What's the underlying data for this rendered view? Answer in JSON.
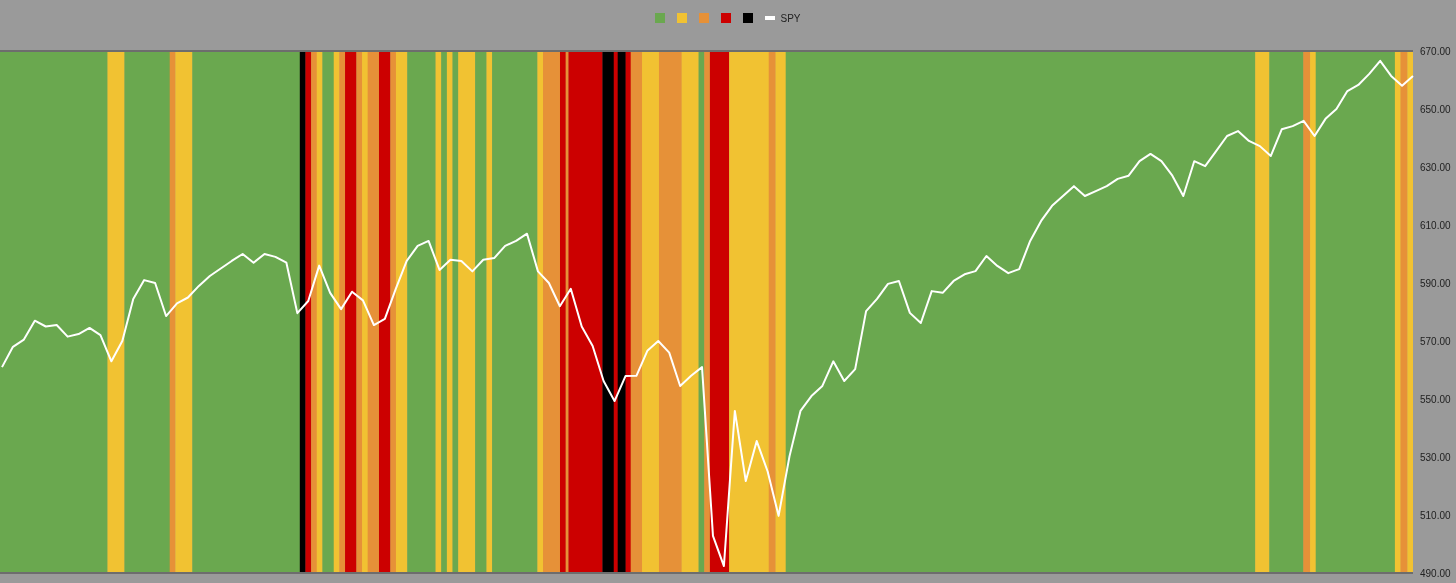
{
  "legend": [
    {
      "color": "#6aa84f"
    },
    {
      "color": "#f1c232"
    },
    {
      "color": "#e69138"
    },
    {
      "color": "#cc0000"
    },
    {
      "color": "#000000"
    }
  ],
  "chart_data": {
    "type": "line",
    "ylim": [
      490,
      670
    ],
    "yticks": [
      {
        "value": 490,
        "label": "490.00"
      },
      {
        "value": 510,
        "label": "510.00"
      },
      {
        "value": 530,
        "label": "530.00"
      },
      {
        "value": 550,
        "label": "550.00"
      },
      {
        "value": 570,
        "label": "570.00"
      },
      {
        "value": 590,
        "label": "590.00"
      },
      {
        "value": 610,
        "label": "610.00"
      },
      {
        "value": 630,
        "label": "630.00"
      },
      {
        "value": 650,
        "label": "650.00"
      },
      {
        "value": 670,
        "label": "670.00"
      }
    ],
    "series": [
      {
        "name": "SPY",
        "color": "#ffffff",
        "values": [
          561,
          568,
          570.5,
          577,
          575,
          575.5,
          571.5,
          572.4,
          574.5,
          572,
          563,
          570,
          584.5,
          591,
          590,
          578.6,
          583,
          585,
          589,
          592.4,
          595,
          597.6,
          600,
          597,
          600,
          599,
          597,
          579.6,
          583.8,
          596,
          586.6,
          581,
          587,
          584,
          575.5,
          577.6,
          588,
          597.6,
          602.8,
          604.5,
          594.5,
          598,
          597.6,
          594,
          598,
          598.6,
          602.8,
          604.5,
          607,
          594,
          590,
          582,
          588,
          575,
          568.3,
          556.2,
          549.3,
          557.9,
          558,
          566.6,
          570,
          566,
          554.5,
          558,
          561,
          502.8,
          492.4,
          545.9,
          521.7,
          535.5,
          525,
          509.7,
          530.3,
          545.9,
          551,
          554.5,
          563,
          556.2,
          560.3,
          580.3,
          584.5,
          589.7,
          590.7,
          579.7,
          576.2,
          587.2,
          586.6,
          590.7,
          593,
          594.1,
          599.3,
          595.9,
          593.4,
          594.8,
          604.5,
          611.4,
          616.6,
          620,
          623.4,
          620,
          621.7,
          623.4,
          625.9,
          627,
          632,
          634.5,
          632,
          627,
          620,
          632,
          630.3,
          635.5,
          640.7,
          642.4,
          639,
          637.2,
          633.8,
          643,
          644.1,
          645.9,
          640.7,
          646.6,
          650,
          656.2,
          658.3,
          662.1,
          666.6,
          661.4,
          658,
          661.4
        ]
      }
    ]
  }
}
